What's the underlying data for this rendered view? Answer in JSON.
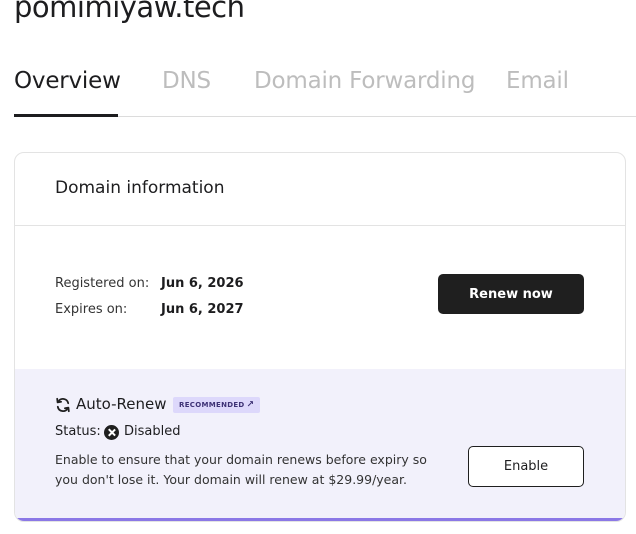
{
  "domain": {
    "name": "pomimiyaw.tech"
  },
  "tabs": [
    {
      "label": "Overview",
      "active": true
    },
    {
      "label": "DNS",
      "active": false
    },
    {
      "label": "Domain Forwarding",
      "active": false
    },
    {
      "label": "Email",
      "active": false
    }
  ],
  "card": {
    "title": "Domain information",
    "registered_label": "Registered on:",
    "registered_value": "Jun 6, 2026",
    "expires_label": "Expires on:",
    "expires_value": "Jun 6, 2027",
    "renew_button": "Renew now"
  },
  "autorenew": {
    "title": "Auto-Renew",
    "badge": "RECOMMENDED",
    "status_label": "Status:",
    "status_value": "Disabled",
    "description": "Enable to ensure that your domain renews before expiry so you don't lose it. Your domain will renew at $29.99/year.",
    "enable_button": "Enable"
  },
  "colors": {
    "accent": "#8b78e6",
    "autorenew_bg": "#f2f1fb",
    "badge_bg": "#ddd8fb",
    "primary_button": "#1f1f1f"
  },
  "icons": {
    "autorenew": "refresh-icon",
    "status": "x-circle-icon",
    "badge": "external-link-icon"
  }
}
